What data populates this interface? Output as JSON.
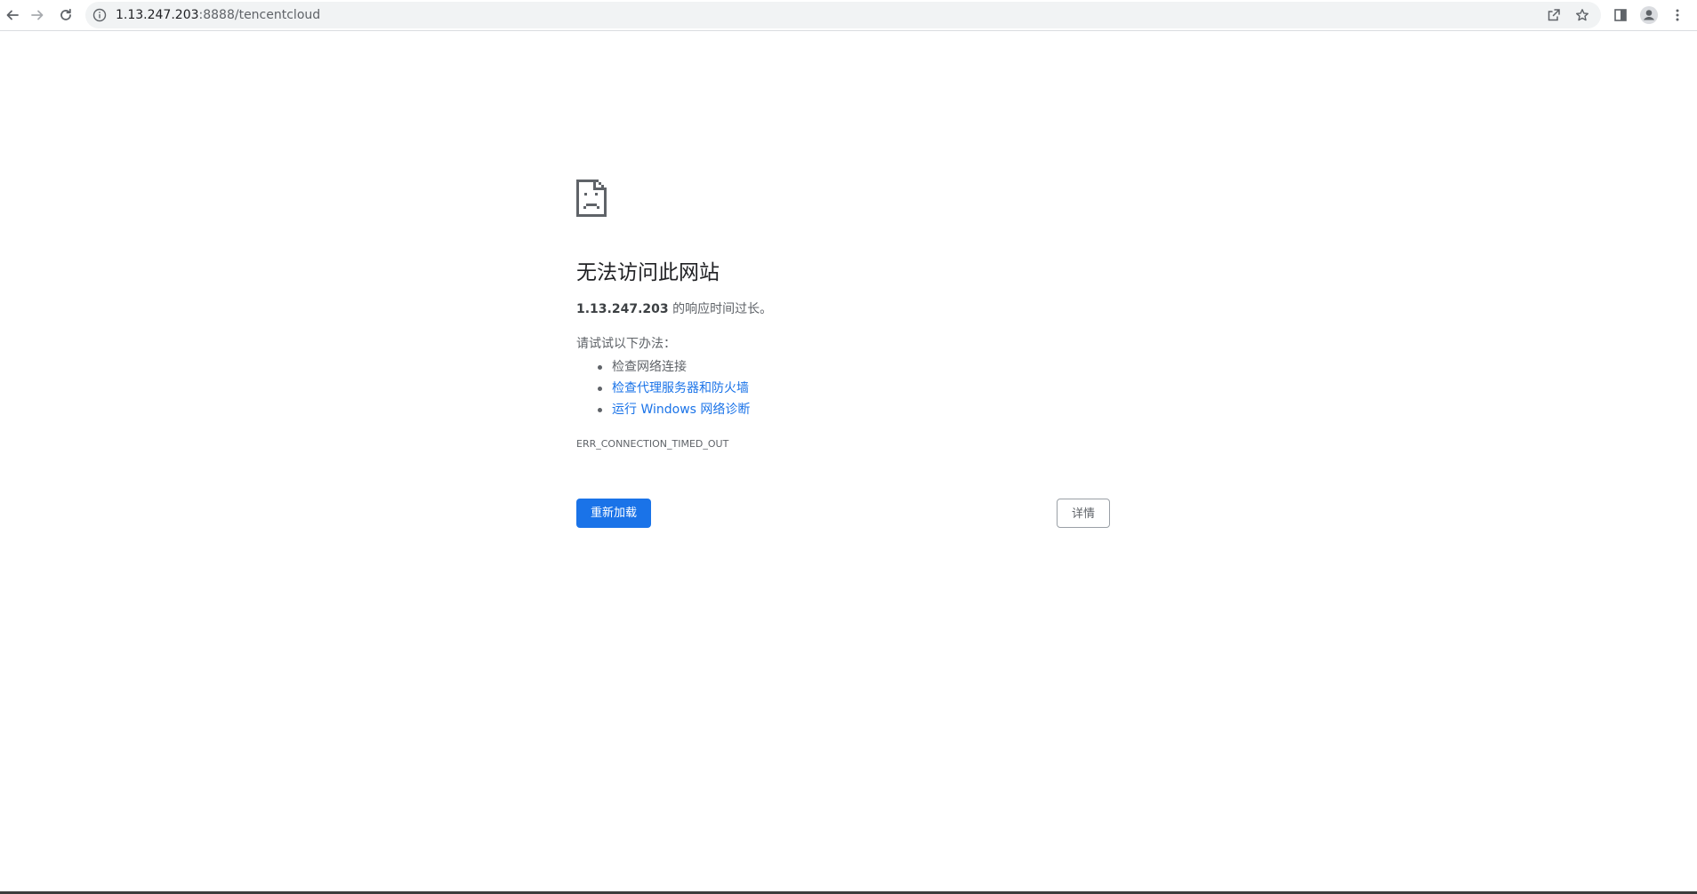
{
  "toolbar": {
    "url_host": "1.13.247.203",
    "url_rest": ":8888/tencentcloud"
  },
  "error": {
    "title": "无法访问此网站",
    "host_bold": "1.13.247.203",
    "summary_suffix": " 的响应时间过长。",
    "try_label": "请试试以下办法：",
    "suggestions": [
      "检查网络连接",
      "检查代理服务器和防火墙",
      "运行 Windows 网络诊断"
    ],
    "code": "ERR_CONNECTION_TIMED_OUT"
  },
  "buttons": {
    "reload": "重新加载",
    "details": "详情"
  },
  "colors": {
    "accent": "#1a73e8",
    "text": "#202124",
    "secondary": "#5f6368"
  }
}
